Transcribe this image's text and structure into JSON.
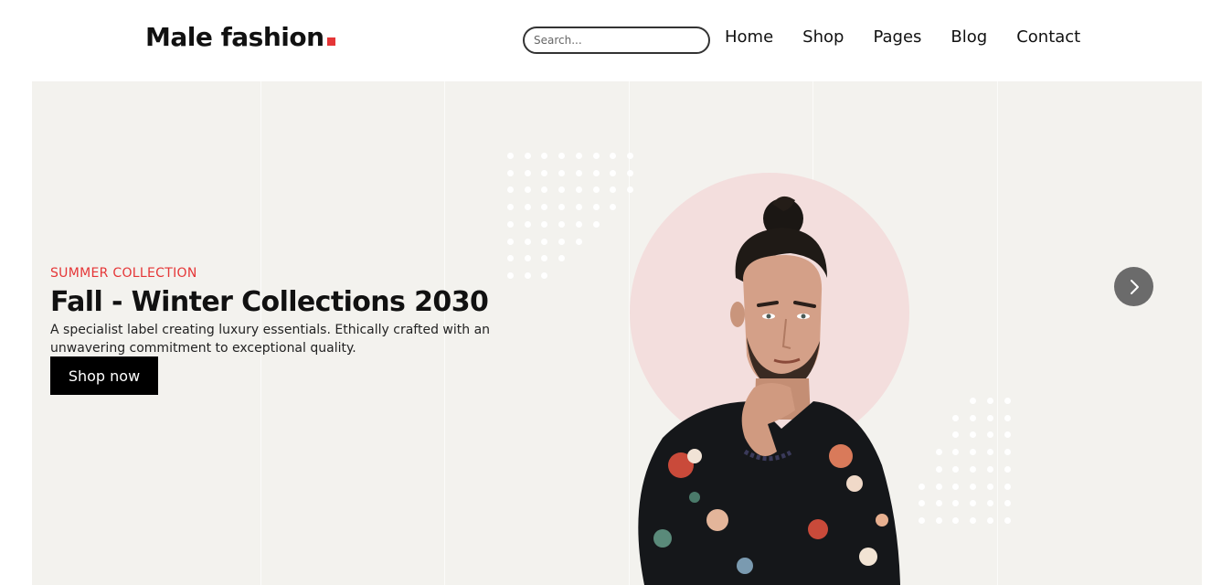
{
  "header": {
    "logo_text": "Male fashion",
    "search_placeholder": "Search...",
    "nav": [
      "Home",
      "Shop",
      "Pages",
      "Blog",
      "Contact"
    ]
  },
  "hero": {
    "subtitle": "SUMMER COLLECTION",
    "title": "Fall - Winter Collections 2030",
    "description": "A specialist label creating luxury essentials. Ethically crafted with an unwavering commitment to exceptional quality.",
    "button_label": "Shop now",
    "next_icon": "chevron-right-icon",
    "model_image": "man-in-floral-shirt"
  },
  "colors": {
    "accent": "#e53637",
    "hero_bg": "#f3f2ee",
    "circle": "#f3dedd",
    "button_bg": "#000000"
  }
}
